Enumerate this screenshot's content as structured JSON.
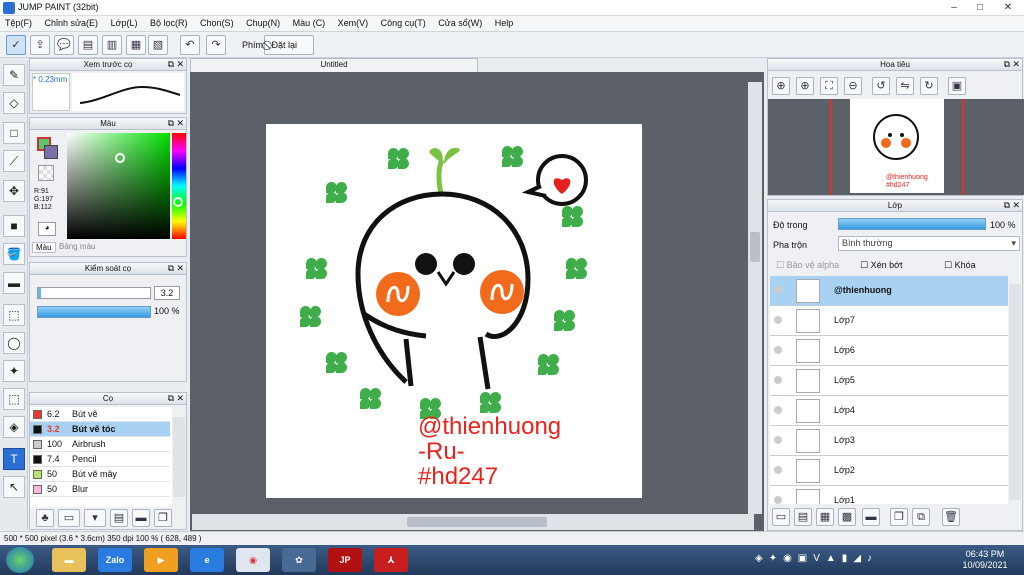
{
  "window": {
    "title": "JUMP PAINT (32bit)"
  },
  "menu": [
    "Tệp(F)",
    "Chỉnh sửa(E)",
    "Lớp(L)",
    "Bộ lọc(R)",
    "Chọn(S)",
    "Chụp(N)",
    "Màu (C)",
    "Xem(V)",
    "Công cụ(T)",
    "Cửa sổ(W)",
    "Help"
  ],
  "toolbar": {
    "key_label": "Phím",
    "reset_label": "Đặt lại"
  },
  "panels": {
    "brush_preview": {
      "title": "Xem trước cọ",
      "size": "* 0.23mm"
    },
    "color": {
      "title": "Màu",
      "r": "R:91",
      "g": "G:197",
      "b": "B:112",
      "tab_color": "Màu",
      "tab_palette": "Bảng màu",
      "main_color": "#5bc570",
      "sub_color": "#7a6fa8"
    },
    "brush_control": {
      "title": "Kiểm soát cọ",
      "size_value": "3.2",
      "opacity_value": "100 %"
    },
    "brush": {
      "title": "Cọ",
      "items": [
        {
          "size": "6.2",
          "name": "Bút vẽ",
          "color": "#e53935"
        },
        {
          "size": "3.2",
          "name": "Bút vẽ tóc",
          "color": "#111111"
        },
        {
          "size": "100",
          "name": "Airbrush",
          "color": "#cccccc"
        },
        {
          "size": "7.4",
          "name": "Pencil",
          "color": "#111111"
        },
        {
          "size": "50",
          "name": "Bút vẽ mây",
          "color": "#b6e36a"
        },
        {
          "size": "50",
          "name": "Blur",
          "color": "#f8b8e0"
        }
      ]
    },
    "navigator": {
      "title": "Hoa tiêu"
    },
    "layer": {
      "title": "Lớp",
      "opacity_label": "Độ trong",
      "opacity_value": "100 %",
      "blend_label": "Pha trộn",
      "blend_value": "Bình thường",
      "protect_alpha": "Bảo vệ alpha",
      "clip": "Xén bớt",
      "lock": "Khóa",
      "layers": [
        "@thienhuong",
        "Lớp7",
        "Lớp6",
        "Lớp5",
        "Lớp4",
        "Lớp3",
        "Lớp2",
        "Lớp1"
      ]
    }
  },
  "document": {
    "tab": "Untitled",
    "text_line1": "@thienhuong",
    "text_line2": "-Ru-",
    "text_line3": "#hd247"
  },
  "status": "500 * 500 pixel   (3.6 * 3.6cm)   350 dpi   100 %   ( 628, 489 )",
  "taskbar": {
    "time": "06:43 PM",
    "date": "10/09/2021",
    "zalo": "Zalo"
  }
}
